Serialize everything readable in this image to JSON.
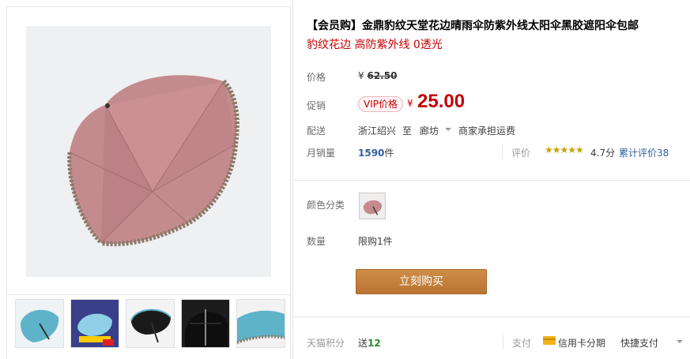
{
  "product": {
    "title": "【会员购】金鼎豹纹天堂花边晴雨伞防紫外线太阳伞黑胶遮阳伞包邮",
    "subtitle": "豹纹花边 高防紫外线 0透光"
  },
  "price": {
    "label": "价格",
    "currency": "¥",
    "original": "62.50"
  },
  "promo": {
    "label": "促销",
    "badge": "VIP价格",
    "currency": "¥",
    "price": "25.00"
  },
  "shipping": {
    "label": "配送",
    "from": "浙江绍兴",
    "to_word": "至",
    "destination": "廊坊",
    "fee": "商家承担运费"
  },
  "sales": {
    "label": "月销量",
    "count": "1590",
    "unit": "件"
  },
  "rating": {
    "label": "评价",
    "stars": "★★★★★",
    "score": "4.7分",
    "reviews_prefix": "累计评价",
    "reviews_count": "38"
  },
  "color": {
    "label": "颜色分类"
  },
  "quantity": {
    "label": "数量",
    "limit": "限购1件"
  },
  "buy_button": "立刻购买",
  "points": {
    "label": "天猫积分",
    "prefix": "送",
    "value": "12"
  },
  "payment": {
    "label": "支付",
    "credit_card": "信用卡分期",
    "quick": "快捷支付"
  },
  "colors": {
    "price_red": "#c40000",
    "button": "#c7843a",
    "link_blue": "#2f5e9e",
    "umbrella_pink": "#c48b8e"
  },
  "icons": [
    "umbrella-product-image",
    "caret-down-icon",
    "star-icon",
    "credit-card-icon"
  ]
}
